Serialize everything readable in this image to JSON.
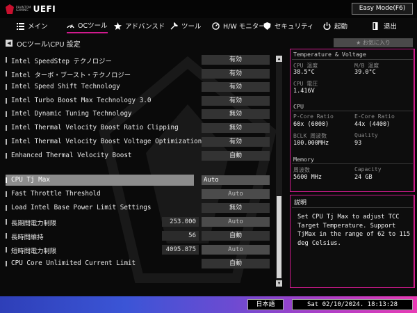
{
  "app": {
    "logo_small_top": "PHANTOM",
    "logo_small_bottom": "GAMING",
    "logo_big": "UEFI",
    "mode_button": "Easy Mode(F6)"
  },
  "nav": {
    "items": [
      {
        "icon": "list-icon",
        "label": "メイン"
      },
      {
        "icon": "oc-tweaker-icon",
        "label": "OCツール"
      },
      {
        "icon": "star-icon",
        "label": "アドバンスド"
      },
      {
        "icon": "tools-icon",
        "label": "ツール"
      },
      {
        "icon": "hw-monitor-icon",
        "label": "H/W モニター"
      },
      {
        "icon": "shield-icon",
        "label": "セキュリティ"
      },
      {
        "icon": "power-icon",
        "label": "起動"
      },
      {
        "icon": "exit-icon",
        "label": "退出"
      }
    ],
    "active_index": 1
  },
  "breadcrumb": {
    "path": "OCツール\\CPU 設定",
    "favorite_label": "★ お気に入り"
  },
  "settings": [
    {
      "label": "Intel SpeedStep テクノロジー",
      "value": "有効"
    },
    {
      "label": "Intel ターボ・ブースト・テクノロジー",
      "value": "有効"
    },
    {
      "label": "Intel Speed Shift Technology",
      "value": "有効"
    },
    {
      "label": "Intel Turbo Boost Max Technology 3.0",
      "value": "有効"
    },
    {
      "label": "Intel Dynamic Tuning Technology",
      "value": "無効"
    },
    {
      "label": "Intel Thermal Velocity Boost Ratio Clipping",
      "value": "無効"
    },
    {
      "label": "Intel Thermal Velocity Boost Voltage Optimizations",
      "value": "有効"
    },
    {
      "label": "Enhanced Thermal Velocity Boost",
      "value": "自動"
    },
    {
      "label": "CPU Tj Max",
      "value": "Auto"
    },
    {
      "label": "Fast Throttle Threshold",
      "value": "Auto"
    },
    {
      "label": "Load Intel Base Power Limit Settings",
      "value": "無効"
    },
    {
      "label": "長期間電力制限",
      "number": "253.000",
      "value": "Auto"
    },
    {
      "label": "長時間維持",
      "number": "56",
      "value": "自動"
    },
    {
      "label": "短時間電力制限",
      "number": "4095.875",
      "value": "Auto"
    },
    {
      "label": "CPU Core Unlimited Current Limit",
      "value": "自動"
    }
  ],
  "monitor": {
    "title": "Temperature & Voltage",
    "cpu_temp_label": "CPU 温度",
    "cpu_temp": "38.5°C",
    "mb_temp_label": "M/B 温度",
    "mb_temp": "39.0°C",
    "cpu_volt_label": "CPU 電圧",
    "cpu_volt": "1.416V",
    "cpu_title": "CPU",
    "pcore_label": "P-Core Ratio",
    "pcore": "60x (6000)",
    "ecore_label": "E-Core Ratio",
    "ecore": "44x (4400)",
    "bclk_label": "BCLK 周波数",
    "bclk": "100.000MHz",
    "quality_label": "Quality",
    "quality": "93",
    "memory_title": "Memory",
    "freq_label": "周波数",
    "freq": "5600 MHz",
    "cap_label": "Capacity",
    "cap": "24 GB"
  },
  "description": {
    "title": "説明",
    "body": "Set CPU Tj Max to adjust TCC Target Temperature. Support TjMax in the range of 62 to 115 deg Celsius."
  },
  "footer": {
    "language": "日本語",
    "datetime": "Sat 02/10/2024. 18:13:28"
  },
  "colors": {
    "accent": "#d11a8e",
    "background": "#0a0a0a"
  }
}
